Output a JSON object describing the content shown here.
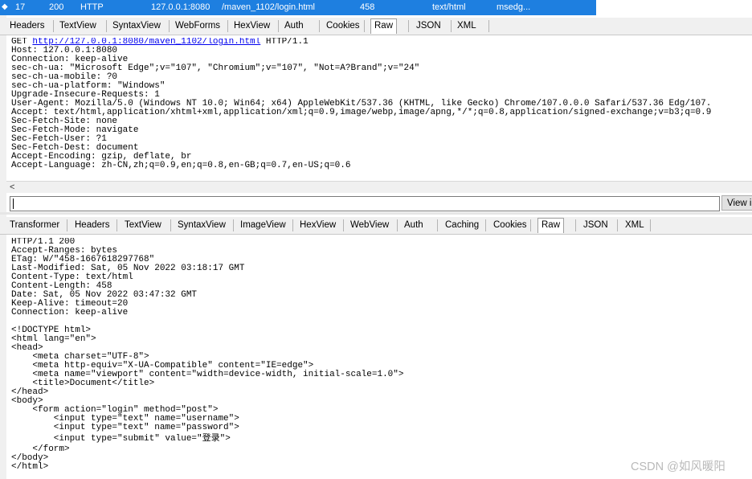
{
  "session_row": {
    "id": "17",
    "result": "200",
    "protocol": "HTTP",
    "host": "127.0.0.1:8080",
    "url": "/maven_1102/login.html",
    "body": "458",
    "content_type": "text/html",
    "process": "msedg..."
  },
  "request_tabs": [
    "Headers",
    "TextView",
    "SyntaxView",
    "WebForms",
    "HexView",
    "Auth",
    "Cookies",
    "Raw",
    "JSON",
    "XML"
  ],
  "request_active_tab": "Raw",
  "request": {
    "first_line_prefix": "GET ",
    "first_line_url": "http://127.0.0.1:8080/maven_1102/login.html",
    "first_line_suffix": " HTTP/1.1",
    "lines": [
      "Host: 127.0.0.1:8080",
      "Connection: keep-alive",
      "sec-ch-ua: \"Microsoft Edge\";v=\"107\", \"Chromium\";v=\"107\", \"Not=A?Brand\";v=\"24\"",
      "sec-ch-ua-mobile: ?0",
      "sec-ch-ua-platform: \"Windows\"",
      "Upgrade-Insecure-Requests: 1",
      "User-Agent: Mozilla/5.0 (Windows NT 10.0; Win64; x64) AppleWebKit/537.36 (KHTML, like Gecko) Chrome/107.0.0.0 Safari/537.36 Edg/107.",
      "Accept: text/html,application/xhtml+xml,application/xml;q=0.9,image/webp,image/apng,*/*;q=0.8,application/signed-exchange;v=b3;q=0.9",
      "Sec-Fetch-Site: none",
      "Sec-Fetch-Mode: navigate",
      "Sec-Fetch-User: ?1",
      "Sec-Fetch-Dest: document",
      "Accept-Encoding: gzip, deflate, br",
      "Accept-Language: zh-CN,zh;q=0.9,en;q=0.8,en-GB;q=0.7,en-US;q=0.6"
    ]
  },
  "scroll_left_glyph": "<",
  "find_input_value": "",
  "view_button_label": "View i",
  "response_tabs": [
    "Transformer",
    "Headers",
    "TextView",
    "SyntaxView",
    "ImageView",
    "HexView",
    "WebView",
    "Auth",
    "Caching",
    "Cookies",
    "Raw",
    "JSON",
    "XML"
  ],
  "response_active_tab": "Raw",
  "response_lines": [
    "HTTP/1.1 200",
    "Accept-Ranges: bytes",
    "ETag: W/\"458-1667618297768\"",
    "Last-Modified: Sat, 05 Nov 2022 03:18:17 GMT",
    "Content-Type: text/html",
    "Content-Length: 458",
    "Date: Sat, 05 Nov 2022 03:47:32 GMT",
    "Keep-Alive: timeout=20",
    "Connection: keep-alive",
    "",
    "<!DOCTYPE html>",
    "<html lang=\"en\">",
    "<head>",
    "    <meta charset=\"UTF-8\">",
    "    <meta http-equiv=\"X-UA-Compatible\" content=\"IE=edge\">",
    "    <meta name=\"viewport\" content=\"width=device-width, initial-scale=1.0\">",
    "    <title>Document</title>",
    "</head>",
    "<body>",
    "    <form action=\"login\" method=\"post\">",
    "        <input type=\"text\" name=\"username\">",
    "        <input type=\"text\" name=\"password\">",
    "        <input type=\"submit\" value=\"登录\">",
    "    </form>",
    "</body>",
    "</html>"
  ],
  "watermark": "CSDN @如风暖阳"
}
